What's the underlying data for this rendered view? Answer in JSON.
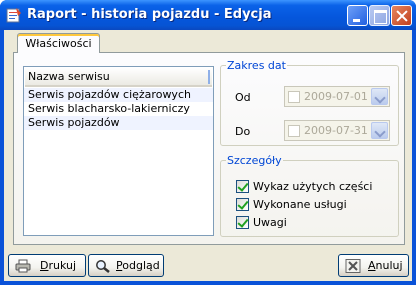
{
  "window": {
    "title": "Raport - historia pojazdu - Edycja"
  },
  "tabs": [
    {
      "label": "Właściwości",
      "active": true
    }
  ],
  "service_list": {
    "header": "Nazwa serwisu",
    "rows": [
      "Serwis pojazdów ciężarowych",
      "Serwis blacharsko-lakierniczy",
      "Serwis pojazdów"
    ]
  },
  "date_range": {
    "legend": "Zakres dat",
    "from_label": "Od",
    "from_value": "2009-07-01",
    "from_enabled": false,
    "to_label": "Do",
    "to_value": "2009-07-31",
    "to_enabled": false
  },
  "details": {
    "legend": "Szczegóły",
    "options": [
      {
        "label": "Wykaz użytych części",
        "checked": true
      },
      {
        "label": "Wykonane usługi",
        "checked": true
      },
      {
        "label": "Uwagi",
        "checked": true
      }
    ]
  },
  "buttons": {
    "print_mnemonic": "D",
    "print_rest": "rukuj",
    "preview_mnemonic": "P",
    "preview_rest": "odgląd",
    "cancel_mnemonic": "A",
    "cancel_rest": "nuluj"
  },
  "colors": {
    "title_bar": "#0556DC",
    "group_legend": "#0046D5",
    "dialog_bg": "#ECE9D8",
    "checkmark": "#21A121"
  }
}
